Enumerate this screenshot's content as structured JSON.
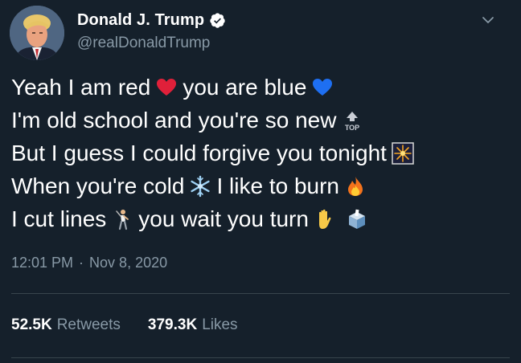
{
  "header": {
    "display_name": "Donald J. Trump",
    "handle": "@realDonaldTrump",
    "verified": true,
    "avatar_icon": "profile-photo",
    "menu_icon": "chevron-down-icon"
  },
  "tweet": {
    "lines": [
      {
        "segments": [
          {
            "text": "Yeah I am red"
          },
          {
            "emoji": "red-heart-icon"
          },
          {
            "text": "you are blue"
          },
          {
            "emoji": "blue-heart-icon"
          }
        ]
      },
      {
        "segments": [
          {
            "text": "I'm old school and you're so new"
          },
          {
            "emoji": "top-arrow-icon",
            "label": "TOP"
          }
        ]
      },
      {
        "segments": [
          {
            "text": "But I guess I could forgive you tonight"
          },
          {
            "emoji": "fireworks-icon"
          }
        ]
      },
      {
        "segments": [
          {
            "text": "When you're cold"
          },
          {
            "emoji": "snowflake-icon"
          },
          {
            "text": "I like to burn"
          },
          {
            "emoji": "fire-icon"
          }
        ]
      },
      {
        "segments": [
          {
            "text": "I cut lines"
          },
          {
            "emoji": "golfer-icon"
          },
          {
            "text": "you wait you turn"
          },
          {
            "emoji": "raised-hand-icon"
          },
          {
            "emoji": "ballot-box-icon"
          }
        ]
      }
    ]
  },
  "meta": {
    "time": "12:01 PM",
    "separator": "·",
    "date": "Nov 8, 2020"
  },
  "stats": {
    "retweets_count": "52.5K",
    "retweets_label": "Retweets",
    "likes_count": "379.3K",
    "likes_label": "Likes"
  },
  "colors": {
    "background": "#15202b",
    "text_primary": "#ffffff",
    "text_secondary": "#8899a6",
    "divider": "#38444d",
    "verified": "#ffffff"
  }
}
